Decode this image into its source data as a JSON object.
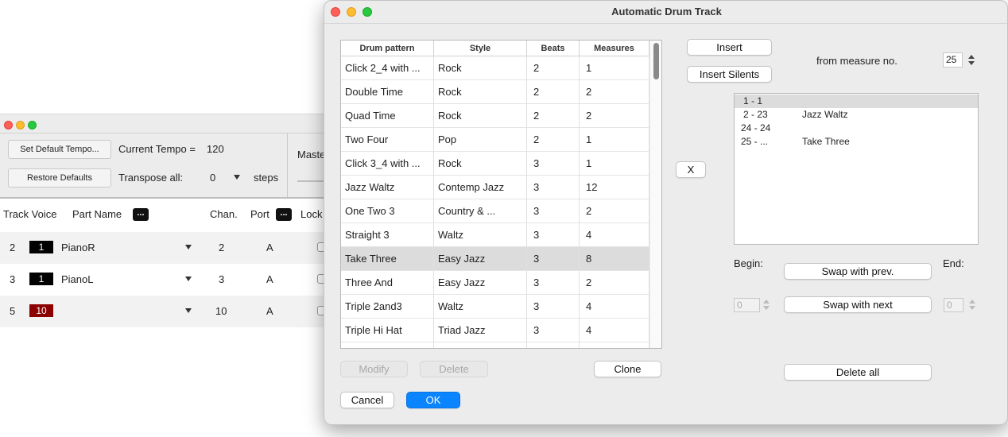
{
  "background_window": {
    "set_default_tempo_label": "Set Default Tempo...",
    "restore_defaults_label": "Restore Defaults",
    "current_tempo_label": "Current Tempo =",
    "current_tempo_value": "120",
    "transpose_label": "Transpose all:",
    "transpose_value": "0",
    "steps_label": "steps",
    "master_label": "Maste",
    "columns": {
      "track_voice": "Track Voice",
      "part_name": "Part Name",
      "part_name_btn": "...",
      "chan": "Chan.",
      "port": "Port",
      "port_btn": "...",
      "lock": "Lock"
    },
    "rows": [
      {
        "track": "2",
        "voice": "1",
        "voice_color": "#000000",
        "name": "PianoR",
        "chan": "2",
        "port": "A"
      },
      {
        "track": "3",
        "voice": "1",
        "voice_color": "#000000",
        "name": "PianoL",
        "chan": "3",
        "port": "A"
      },
      {
        "track": "5",
        "voice": "10",
        "voice_color": "#8b0000",
        "name": "",
        "chan": "10",
        "port": "A"
      }
    ]
  },
  "dialog": {
    "title": "Automatic Drum Track",
    "table": {
      "headers": [
        "Drum pattern",
        "Style",
        "Beats",
        "Measures"
      ],
      "rows": [
        [
          "Click 2_4 with ...",
          "Rock",
          "2",
          "1"
        ],
        [
          "Double Time",
          "Rock",
          "2",
          "2"
        ],
        [
          "Quad Time",
          "Rock",
          "2",
          "2"
        ],
        [
          "Two Four",
          "Pop",
          "2",
          "1"
        ],
        [
          "Click 3_4 with ...",
          "Rock",
          "3",
          "1"
        ],
        [
          "Jazz Waltz",
          "Contemp Jazz",
          "3",
          "12"
        ],
        [
          "One Two 3",
          "Country & ...",
          "3",
          "2"
        ],
        [
          "Straight 3",
          "Waltz",
          "3",
          "4"
        ],
        [
          "Take Three",
          "Easy Jazz",
          "3",
          "8"
        ],
        [
          "Three And",
          "Easy Jazz",
          "3",
          "2"
        ],
        [
          "Triple 2and3",
          "Waltz",
          "3",
          "4"
        ],
        [
          "Triple Hi Hat",
          "Triad Jazz",
          "3",
          "4"
        ]
      ],
      "selected_row": 8
    },
    "buttons": {
      "insert": "Insert",
      "insert_silents": "Insert Silents",
      "x": "X",
      "modify": "Modify",
      "delete": "Delete",
      "clone": "Clone",
      "cancel": "Cancel",
      "ok": "OK",
      "swap_prev": "Swap with prev.",
      "swap_next": "Swap with next",
      "delete_all": "Delete all"
    },
    "from_measure_label": "from measure no.",
    "from_measure_value": "25",
    "sequence": [
      {
        "range": "1 - 1",
        "pattern": ""
      },
      {
        "range": "2 - 23",
        "pattern": "Jazz Waltz"
      },
      {
        "range": "24 - 24",
        "pattern": ""
      },
      {
        "range": "25 - ...",
        "pattern": "Take Three"
      }
    ],
    "begin_label": "Begin:",
    "end_label": "End:",
    "begin_value": "0",
    "end_value": "0"
  }
}
